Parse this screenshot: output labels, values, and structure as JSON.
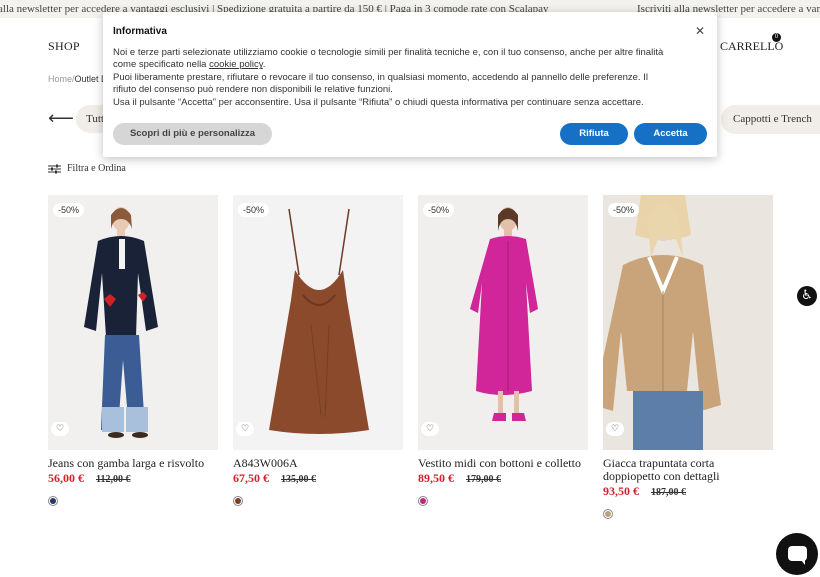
{
  "marquee": {
    "text_left": "alla newsletter per accedere a vantaggi esclusivi  |  Spedizione gratuita a partire da 150 €  |  Paga in 3 comode rate con Scalapay",
    "text_right": "Iscriviti alla newsletter per accedere a vantaggi esclusivi"
  },
  "header": {
    "shop_label": "SHOP",
    "cart_label": "CARRELLO",
    "cart_count": "0"
  },
  "breadcrumb": {
    "home": "Home",
    "separator": "/",
    "current": "Outlet D"
  },
  "categories": {
    "left_chip": "Tutt",
    "right_chip": "Cappotti e Trench"
  },
  "filter": {
    "label": "Filtra e Ordina"
  },
  "products": [
    {
      "badge": "-50%",
      "name": "Jeans con gamba larga e risvolto",
      "price": "56,00 €",
      "original_price": "112,00 €",
      "swatch_color": "#24386b"
    },
    {
      "badge": "-50%",
      "name": "A843W006A",
      "price": "67,50 €",
      "original_price": "135,00 €",
      "swatch_color": "#7a3e2a"
    },
    {
      "badge": "-50%",
      "name": "Vestito midi con bottoni e colletto",
      "price": "89,50 €",
      "original_price": "179,00 €",
      "swatch_color": "#c2287a"
    },
    {
      "badge": "-50%",
      "name": "Giacca trapuntata corta doppiopetto con dettagli",
      "price": "93,50 €",
      "original_price": "187,00 €",
      "swatch_color": "#b7a27c"
    }
  ],
  "cookie": {
    "title": "Informativa",
    "line1": "Noi e terze parti selezionate utilizziamo cookie o tecnologie simili per finalità tecniche e, con il tuo consenso, anche per altre finalità come specificato nella ",
    "policy_link": "cookie policy",
    "line1_end": ".",
    "line2": "Puoi liberamente prestare, rifiutare o revocare il tuo consenso, in qualsiasi momento, accedendo al pannello delle preferenze. Il rifiuto del consenso può rendere non disponibili le relative funzioni.",
    "line3": "Usa il pulsante “Accetta” per acconsentire. Usa il pulsante “Rifiuta” o chiudi questa informativa per continuare senza accettare.",
    "more_label": "Scopri di più e personalizza",
    "reject_label": "Rifiuta",
    "accept_label": "Accetta"
  },
  "colors": {
    "sale": "#d4202b",
    "button_blue": "#1671c6"
  }
}
